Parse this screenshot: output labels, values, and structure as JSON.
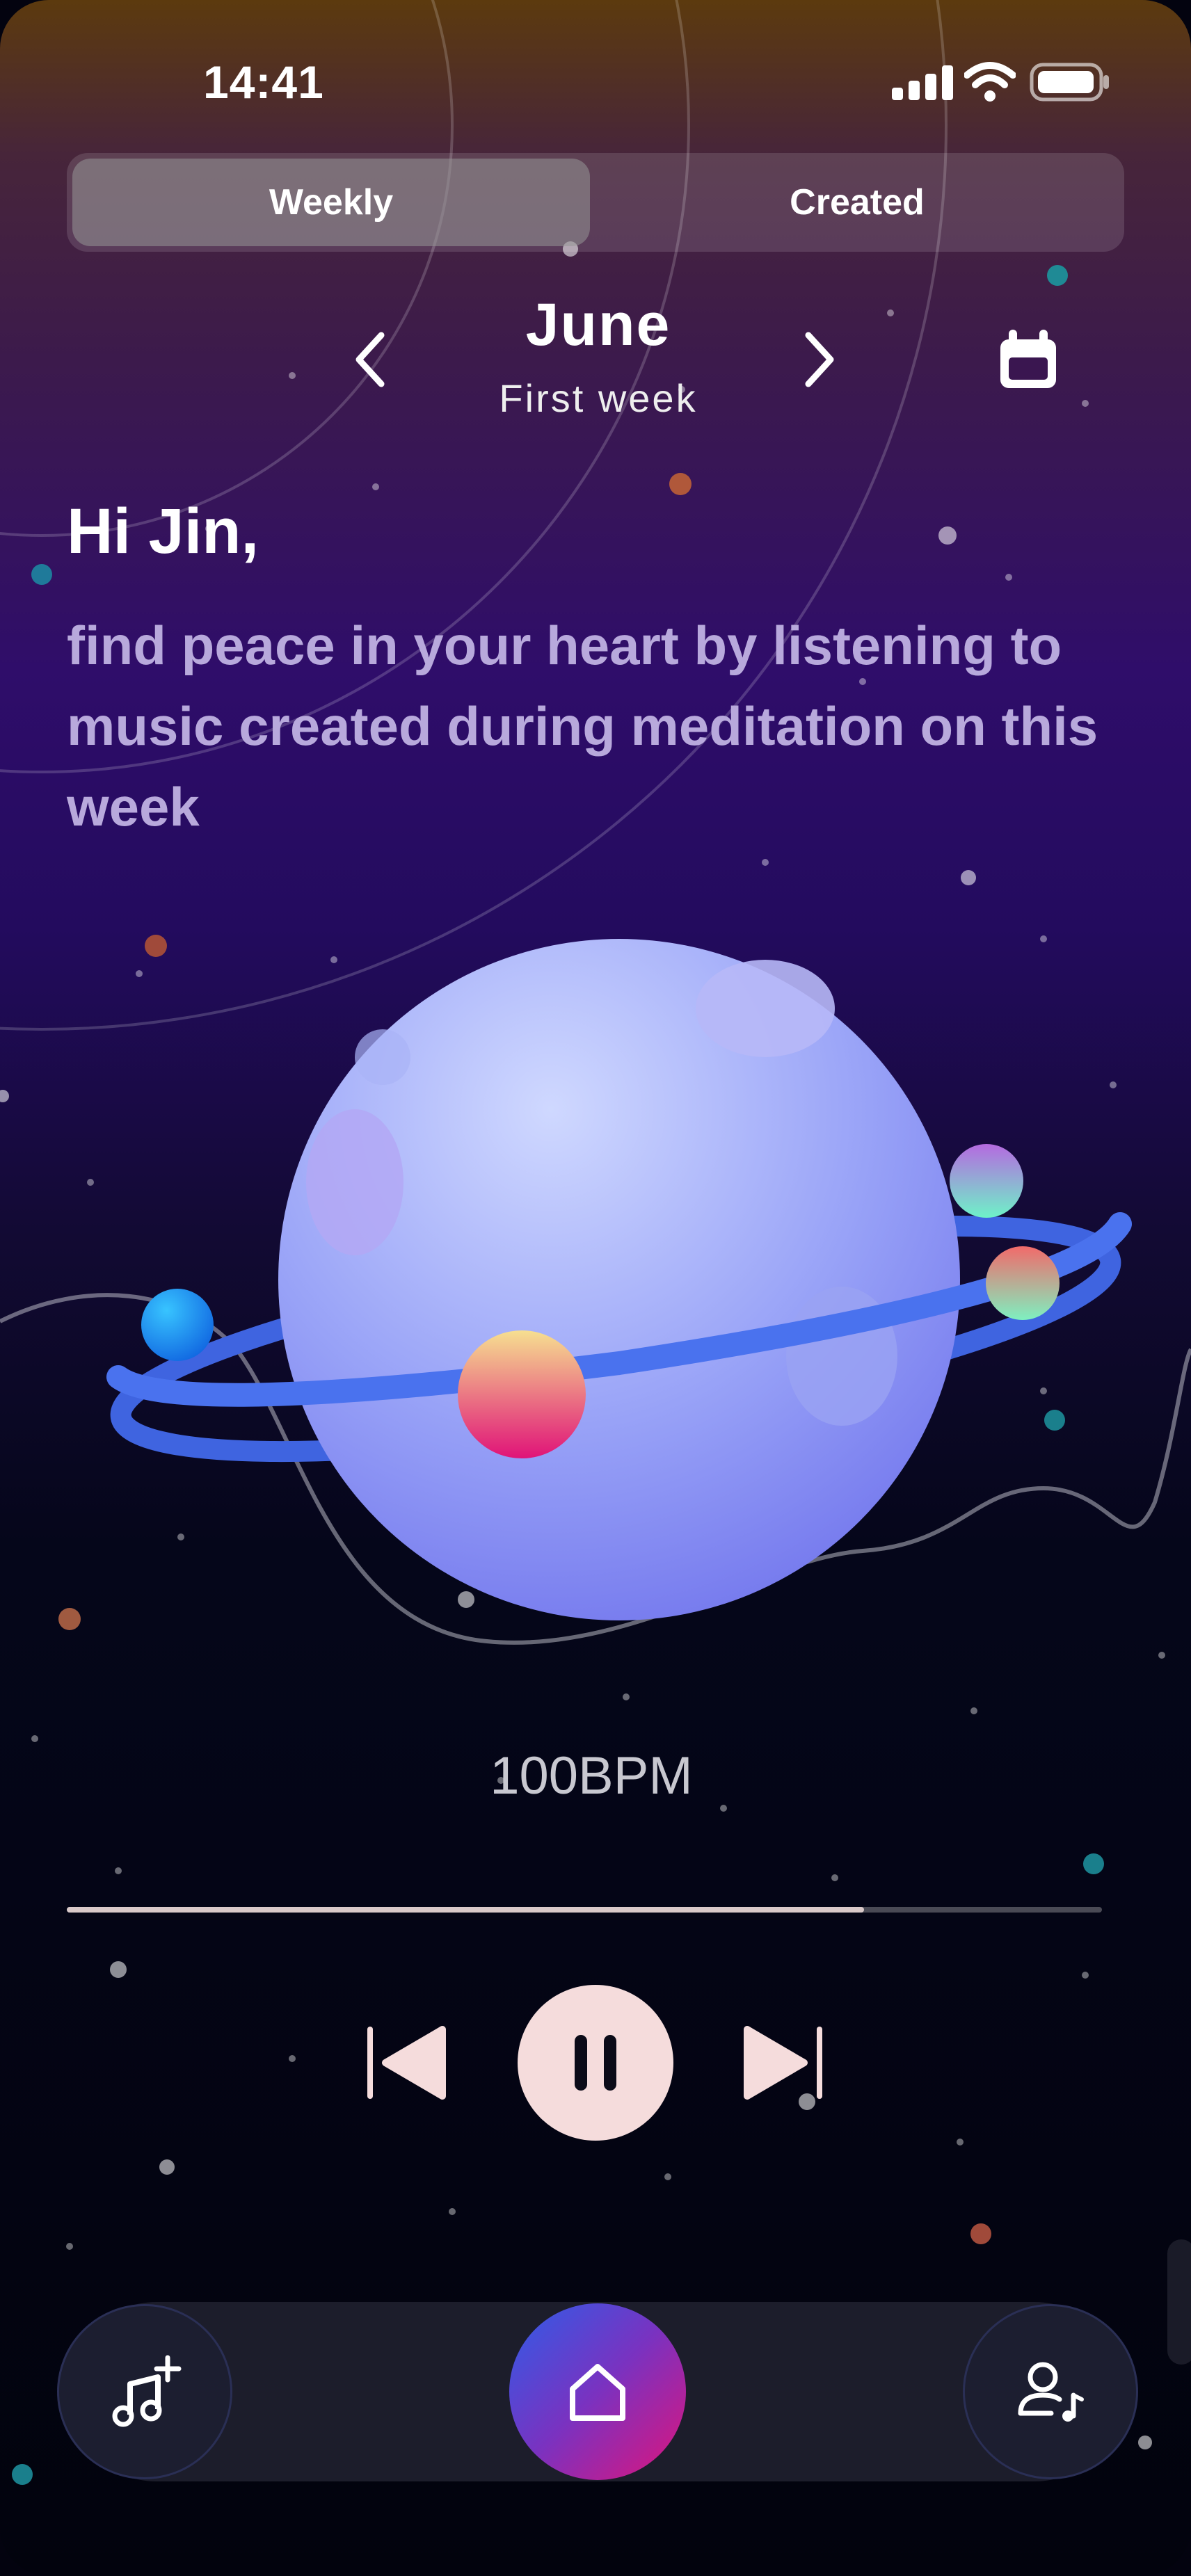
{
  "status_bar": {
    "time": "14:41"
  },
  "tabs": [
    {
      "label": "Weekly",
      "active": true
    },
    {
      "label": "Created",
      "active": false
    }
  ],
  "period": {
    "month": "June",
    "week": "First week"
  },
  "greeting": "Hi Jin,",
  "message": "find peace in your heart by listening to music created during meditation on this week",
  "player": {
    "tempo": "100BPM",
    "progress": 0.77,
    "state": "playing"
  },
  "icons": {
    "prev_month": "chevron-left-icon",
    "next_month": "chevron-right-icon",
    "calendar": "calendar-icon",
    "previous_track": "skip-previous-icon",
    "pause": "pause-icon",
    "next_track": "skip-next-icon",
    "add_music": "music-note-plus-icon",
    "home": "home-icon",
    "profile": "user-music-icon"
  },
  "colors": {
    "accent_gradient_start": "#2e5de8",
    "accent_gradient_end": "#e0147a",
    "play_button": "#f5dcdc",
    "message_text": "#b8a9dc"
  }
}
